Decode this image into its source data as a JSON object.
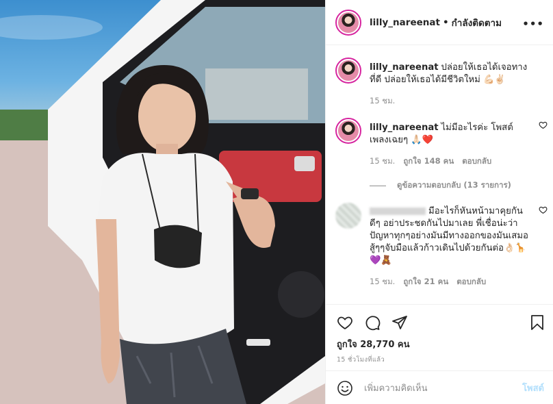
{
  "post": {
    "username": "lilly_nareenat",
    "separator": "•",
    "follow_status": "กำลังติดตาม",
    "more_icon": "more-horizontal-icon"
  },
  "caption": {
    "username": "lilly_nareenat",
    "text": "ปล่อยให้เธอได้เจอทางที่ดี ปล่อยให้เธอได้มีชีวิตใหม่ 💪🏻✌🏻",
    "time": "15 ชม."
  },
  "comments": [
    {
      "username": "lilly_nareenat",
      "text": "ไม่มีอะไรค่ะ โพสต์เพลงเฉยๆ 🙏🏻❤️",
      "time": "15 ชม.",
      "likes": "ถูกใจ 148 คน",
      "reply": "ตอบกลับ"
    },
    {
      "username": "",
      "text": "มีอะไรก็หันหน้ามาคุยกันดีๆ อย่าประชดกันไปมาเลย พี่เชื่อน่ะว่าปัญหาทุกๆอย่างมันมีทางออกของมันเสมอ สู้ๆๆจับมือแล้วก้าวเดินไปด้วยกันต่อ👌🏻🦒💜🧸",
      "time": "15 ชม.",
      "likes": "ถูกใจ 21 คน",
      "reply": "ตอบกลับ"
    }
  ],
  "view_replies": "ดูข้อความตอบกลับ (13 รายการ)",
  "actions": {
    "icons": [
      "heart-icon",
      "comment-icon",
      "share-icon",
      "bookmark-icon"
    ],
    "likes": "ถูกใจ 28,770 คน",
    "time_ago": "15 ชั่วโมงที่แล้ว"
  },
  "add_comment": {
    "placeholder": "เพิ่มความคิดเห็น",
    "post_label": "โพสต์"
  },
  "colors": {
    "story_ring": "#d6249f",
    "post_button_disabled": "#b2dffc",
    "secondary_text": "#8e8e8e",
    "heart_red": "#ed4956"
  }
}
